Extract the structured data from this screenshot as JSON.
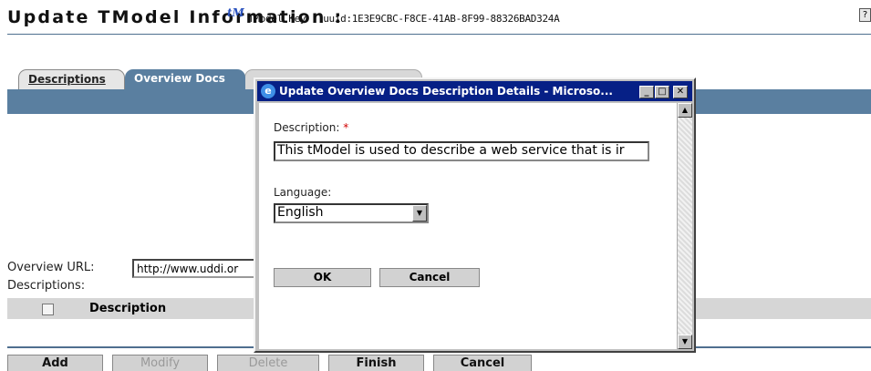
{
  "header": {
    "title": "Update TModel Information :",
    "tm_icon": "tM",
    "tmodel_key": "TModel Key : uuid:1E3E9CBC-F8CE-41AB-8F99-88326BAD324A",
    "help_icon": "?"
  },
  "tabs": [
    {
      "label": "Descriptions"
    },
    {
      "label": "Overview Docs"
    }
  ],
  "form": {
    "overview_url_label": "Overview URL:",
    "overview_url_value": "http://www.uddi.or",
    "descriptions_label": "Descriptions:",
    "table_header": "Description"
  },
  "buttons": [
    {
      "label": "Add",
      "enabled": true
    },
    {
      "label": "Modify",
      "enabled": false
    },
    {
      "label": "Delete",
      "enabled": false
    },
    {
      "label": "Finish",
      "enabled": true
    },
    {
      "label": "Cancel",
      "enabled": true
    }
  ],
  "dialog": {
    "title": "Update Overview Docs Description Details - Microso...",
    "minimize": "_",
    "maximize": "□",
    "close": "✕",
    "description_label": "Description:",
    "required_marker": "*",
    "description_value": "This tModel is used to describe a web service that is ir",
    "language_label": "Language:",
    "language_value": "English",
    "ok_label": "OK",
    "cancel_label": "Cancel"
  },
  "colors": {
    "tab_blue": "#5a7fa0",
    "dialog_titlebar": "#062086",
    "required": "#d00000"
  }
}
